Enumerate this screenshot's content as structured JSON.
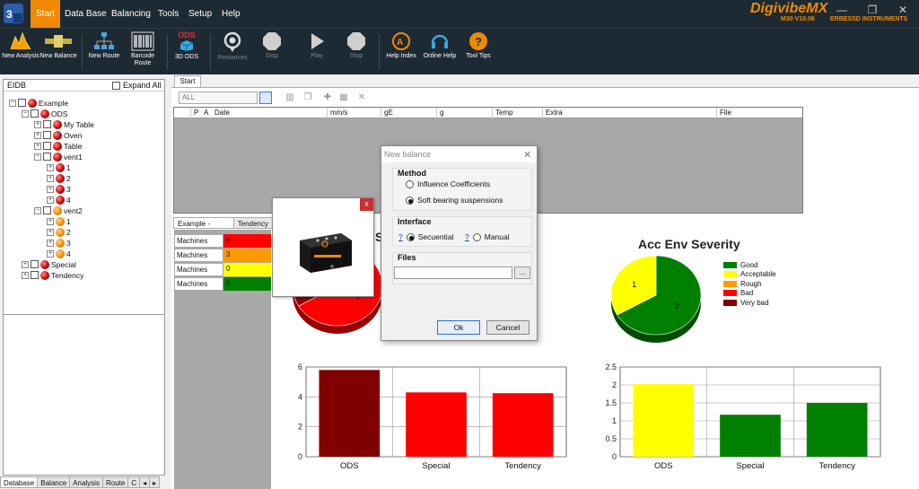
{
  "menubar": {
    "items": [
      "Start",
      "Data Base",
      "Balancing",
      "Tools",
      "Setup",
      "Help"
    ],
    "brand": "DigivibeMX",
    "version": "M30 V10.06",
    "company": "ERBESSD INSTRUMENTS"
  },
  "ribbon": {
    "buttons": [
      {
        "label": "New Analysis",
        "icon": "new-analysis-icon"
      },
      {
        "label": "New Balance",
        "icon": "new-balance-icon"
      },
      {
        "label": "New Route",
        "icon": "new-route-icon"
      },
      {
        "label": "Barcode Route",
        "icon": "barcode-icon"
      },
      {
        "label": "3D ODS",
        "icon": "ods-3d-icon",
        "badge": "ODS"
      },
      {
        "label": "Resources",
        "icon": "resources-icon"
      },
      {
        "label": "Stop",
        "icon": "stop-icon"
      },
      {
        "label": "Play",
        "icon": "play-icon"
      },
      {
        "label": "Stop",
        "icon": "stop-icon"
      },
      {
        "label": "Help Index",
        "icon": "help-index-icon"
      },
      {
        "label": "Online Help",
        "icon": "online-help-icon"
      },
      {
        "label": "Tool Tips",
        "icon": "tool-tips-icon"
      }
    ]
  },
  "tree": {
    "header": "EIDB",
    "expand_all": "Expand All",
    "nodes": {
      "example": "Example",
      "ods": "ODS",
      "my_table": "My Table",
      "oven": "Oven",
      "table": "Table",
      "vent1": "vent1",
      "vent1_children": [
        "1",
        "2",
        "3",
        "4"
      ],
      "vent2": "vent2",
      "vent2_children": [
        "1",
        "2",
        "3",
        "4"
      ],
      "special": "Special",
      "tendency": "Tendency"
    }
  },
  "bottom_tabs": [
    "Database",
    "Balance",
    "Analysis",
    "Route",
    "C"
  ],
  "main": {
    "tab": "Start",
    "filter_value": "ALL",
    "grid_columns": [
      "P",
      "A",
      "Date",
      "mm/s",
      "gE",
      "g",
      "Temp",
      "Extra",
      "File"
    ],
    "subtabs": [
      "Example - Areas",
      "Tendency"
    ],
    "summary": [
      {
        "name": "Machines",
        "value": "6",
        "color": "#ff0000"
      },
      {
        "name": "Machines",
        "value": "3",
        "color": "#ff9900"
      },
      {
        "name": "Machines",
        "value": "0",
        "color": "#ffff00"
      },
      {
        "name": "Machines",
        "value": "0",
        "color": "#008000"
      }
    ],
    "left_title_fragment": "S"
  },
  "chart_data": [
    {
      "type": "pie",
      "title": "",
      "slices": [
        {
          "label": "2",
          "value": 2,
          "color": "#ff0000"
        },
        {
          "label": "",
          "value": 1,
          "color": "#8b0000"
        }
      ]
    },
    {
      "type": "bar",
      "categories": [
        "ODS",
        "Special",
        "Tendency"
      ],
      "values": [
        5.8,
        4.3,
        4.25
      ],
      "colors": [
        "#800000",
        "#ff0000",
        "#ff0000"
      ],
      "ylim": [
        0,
        6
      ],
      "yticks": [
        "0",
        "2",
        "4",
        "6"
      ],
      "grid": true
    },
    {
      "type": "pie",
      "title": "Acc Env Severity",
      "slices": [
        {
          "label": "2",
          "value": 2,
          "color": "#008000"
        },
        {
          "label": "1",
          "value": 1,
          "color": "#ffff00"
        }
      ],
      "legend": [
        {
          "name": "Good",
          "color": "#008000"
        },
        {
          "name": "Acceptable",
          "color": "#ffff00"
        },
        {
          "name": "Rough",
          "color": "#ff9900"
        },
        {
          "name": "Bad",
          "color": "#ff0000"
        },
        {
          "name": "Very bad",
          "color": "#800000"
        }
      ],
      "legend_position": "right"
    },
    {
      "type": "bar",
      "categories": [
        "ODS",
        "Special",
        "Tendency"
      ],
      "values": [
        2.02,
        1.17,
        1.5
      ],
      "colors": [
        "#ffff00",
        "#008000",
        "#008000"
      ],
      "ylim": [
        0,
        2.5
      ],
      "yticks": [
        "0",
        "0.5",
        "1",
        "1.5",
        "2",
        "2.5"
      ],
      "grid": true
    }
  ],
  "dialog": {
    "title": "New balance",
    "method_label": "Method",
    "method_options": [
      "Influence Coefficients",
      "Soft bearing suspensions"
    ],
    "method_selected": 1,
    "interface_label": "Interface",
    "interface_help": "?",
    "interface_options": [
      "Secuential",
      "Manual"
    ],
    "interface_selected": 0,
    "files_label": "Files",
    "browse": "...",
    "ok": "Ok",
    "cancel": "Cancel"
  },
  "popup": {
    "close": "x"
  },
  "colors": {
    "accent": "#f08a00",
    "menubar_bg": "#1e2a33"
  }
}
